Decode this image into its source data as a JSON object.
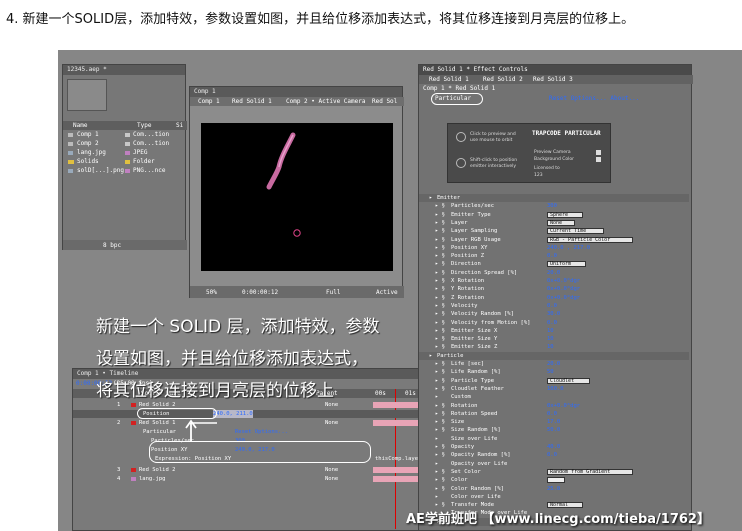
{
  "step": {
    "title": "4. 新建一个SOLID层，添加特效，参数设置如图，并且给位移添加表达式，将其位移连接到月亮层的位移上。"
  },
  "project": {
    "window_title": "12345.aep *",
    "columns": [
      "Name",
      "Type",
      "Si"
    ],
    "items": [
      {
        "name": "Comp 1",
        "type": "Com...tion"
      },
      {
        "name": "Comp 2",
        "type": "Com...tion"
      },
      {
        "name": "lang.jpg",
        "type": "JPEG"
      },
      {
        "name": "Solids",
        "type": "Folder"
      },
      {
        "name": "solD[...].png",
        "type": "PNG...nce"
      }
    ],
    "footer": "8 bpc"
  },
  "comp_viewer": {
    "window_title": "Comp 1",
    "tabs": [
      "Comp 1",
      "Red Solid 1",
      "Comp 2 • Active Camera",
      "Red Sol"
    ],
    "zoom": "50%",
    "timecode": "0:00:00:12",
    "resolution": "Full",
    "camera": "Active"
  },
  "effect_controls": {
    "window_title": "Red Solid 1 * Effect Controls",
    "tabs": [
      "Red Solid 1",
      "Red Solid 2",
      "Red Solid 3"
    ],
    "breadcrumb": "Comp 1 * Red Solid 1",
    "effect_name": "Particular",
    "reset_label": "Reset Options... About...",
    "preview_text_1": "Click to preview and use mouse to orbit",
    "preview_text_2": "Shift-click to position emitter interactively",
    "brand": "TRAPCODE PARTICULAR",
    "preview_camera": "Preview Camera",
    "background_color": "Background Color",
    "licensed": "Licensed to",
    "licensed_to": "123",
    "rows": [
      {
        "label": "Emitter",
        "kind": "section"
      },
      {
        "label": "Particles/sec",
        "value": "300"
      },
      {
        "label": "Emitter Type",
        "dropdown": "Sphere"
      },
      {
        "label": "Layer",
        "dropdown": "None"
      },
      {
        "label": "Layer Sampling",
        "dropdown": "Current Time"
      },
      {
        "label": "Layer RGB Usage",
        "dropdown": "RGB - Particle Color"
      },
      {
        "label": "Position XY",
        "value": "240.0 , 217.0"
      },
      {
        "label": "Position Z",
        "value": "0.0"
      },
      {
        "label": "Direction",
        "dropdown": "Uniform"
      },
      {
        "label": "Direction Spread [%]",
        "value": "20.0"
      },
      {
        "label": "X Rotation",
        "value": "0x+0.0°dgr"
      },
      {
        "label": "Y Rotation",
        "value": "0x+0.0°dgr"
      },
      {
        "label": "Z Rotation",
        "value": "0x+0.0°dgr"
      },
      {
        "label": "Velocity",
        "value": "0.0"
      },
      {
        "label": "Velocity Random [%]",
        "value": "30.0"
      },
      {
        "label": "Velocity from Motion [%]",
        "value": "0.0"
      },
      {
        "label": "Emitter Size X",
        "value": "10"
      },
      {
        "label": "Emitter Size Y",
        "value": "10"
      },
      {
        "label": "Emitter Size Z",
        "value": "10"
      },
      {
        "label": "Particle",
        "kind": "section"
      },
      {
        "label": "Life [sec]",
        "value": "20.0"
      },
      {
        "label": "Life Random [%]",
        "value": "50"
      },
      {
        "label": "Particle Type",
        "dropdown": "Cloudlet"
      },
      {
        "label": "Cloudlet Feather",
        "value": "100.0"
      },
      {
        "label": "Custom",
        "kind": "group"
      },
      {
        "label": "Rotation",
        "value": "0x+0.0°dgr"
      },
      {
        "label": "Rotation Speed",
        "value": "0.0"
      },
      {
        "label": "Size",
        "value": "17.0"
      },
      {
        "label": "Size Random [%]",
        "value": "50.0"
      },
      {
        "label": "Size over Life",
        "kind": "group"
      },
      {
        "label": "Opacity",
        "value": "40.0"
      },
      {
        "label": "Opacity Random [%]",
        "value": "0.0"
      },
      {
        "label": "Opacity over Life",
        "kind": "group"
      },
      {
        "label": "Set Color",
        "dropdown": "Random from Gradient"
      },
      {
        "label": "Color",
        "swatch": true
      },
      {
        "label": "Color Random [%]",
        "value": "25.0"
      },
      {
        "label": "Color over Life",
        "kind": "group"
      },
      {
        "label": "Transfer Mode",
        "dropdown": "Normal"
      },
      {
        "label": "Transfer Mode over Life",
        "kind": "group"
      },
      {
        "label": "Physics",
        "kind": "section"
      }
    ]
  },
  "caption": {
    "line1": "新建一个 SOLID 层，添加特效，参数",
    "line2": "设置如图，并且给位移添加表达式，",
    "line3": "将其位移连接到月亮层的位移上"
  },
  "timeline": {
    "window_title": "Comp 1 • Timeline",
    "timecode": "0:00:00:12",
    "fps": "(25.00 fps)",
    "columns": {
      "source": "Source Name",
      "parent": "Parent"
    },
    "rows": [
      {
        "num": "1",
        "label": "Red Solid 2",
        "parent": "None"
      },
      {
        "num": "",
        "label": "Position",
        "parent": ""
      },
      {
        "num": "2",
        "label": "Red Solid 1",
        "parent": "None"
      },
      {
        "num": "",
        "label": "Particular",
        "parent": "Reset Options..."
      },
      {
        "num": "",
        "label": "Particles/sec",
        "parent": "300"
      },
      {
        "num": "",
        "label": "Position XY",
        "parent": "240.0, 217.0"
      },
      {
        "num": "",
        "label": "Expression: Position XY",
        "parent": ""
      },
      {
        "num": "3",
        "label": "Red Solid 2",
        "parent": "None"
      },
      {
        "num": "4",
        "label": "lang.jpg",
        "parent": "None"
      }
    ],
    "expression_text": "thisComp.layer",
    "ruler": [
      "00s",
      "01s"
    ],
    "position_value": "240.0, 211.0"
  },
  "watermark": "AE学前班吧 【www.linecg.com/tieba/1762】",
  "colors": {
    "accent_blue": "#2d6bff",
    "panel_gray": "#777777",
    "panel_dark": "#5a5a5a",
    "red_swatch": "#d22222",
    "particle_pink": "#c86aa0",
    "layer_bar_pink": "#e8a4b6"
  }
}
